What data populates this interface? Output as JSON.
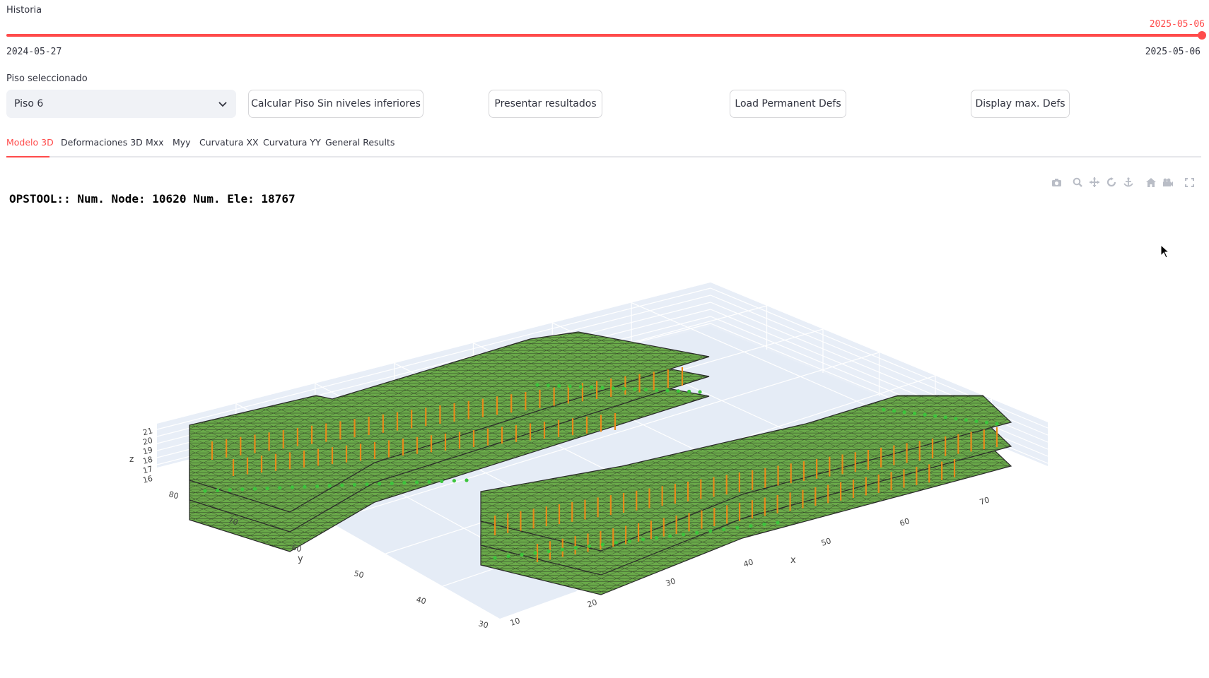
{
  "slider": {
    "label": "Historia",
    "current": "2025-05-06",
    "min": "2024-05-27",
    "max": "2025-05-06",
    "position_fraction": 1.0,
    "accent_color": "#ff4b4b"
  },
  "floor_select": {
    "label": "Piso seleccionado",
    "value": "Piso 6"
  },
  "buttons": {
    "calc": "Calcular Piso Sin niveles inferiores",
    "present": "Presentar resultados",
    "load": "Load Permanent Defs",
    "display": "Display max. Defs"
  },
  "tabs": [
    {
      "label": "Modelo 3D",
      "active": true
    },
    {
      "label": "Deformaciones 3D",
      "active": false
    },
    {
      "label": "Mxx",
      "active": false
    },
    {
      "label": "Myy",
      "active": false
    },
    {
      "label": "Curvatura XX",
      "active": false
    },
    {
      "label": "Curvatura YY",
      "active": false
    },
    {
      "label": "General Results",
      "active": false
    }
  ],
  "modebar_icons": [
    "camera-icon",
    "zoom-icon",
    "pan-icon",
    "orbit-icon",
    "turntable-icon",
    "home-icon",
    "camera-view-icon",
    "fullscreen-icon"
  ],
  "plot": {
    "title": "OPSTOOL:: Num. Node: 10620 Num. Ele: 18767",
    "x_axis": {
      "label": "x",
      "ticks": [
        "10",
        "20",
        "30",
        "40",
        "50",
        "60",
        "70"
      ]
    },
    "y_axis": {
      "label": "y",
      "ticks": [
        "30",
        "40",
        "50",
        "60",
        "70",
        "80"
      ]
    },
    "z_axis": {
      "label": "z",
      "ticks": [
        "16",
        "17",
        "18",
        "19",
        "20",
        "21"
      ]
    },
    "colors": {
      "shell": "#6aaa4a",
      "column": "#e88a1a",
      "support": "#3cc43c",
      "mesh": "#2a2a2a",
      "background": "#e5ecf6"
    }
  }
}
